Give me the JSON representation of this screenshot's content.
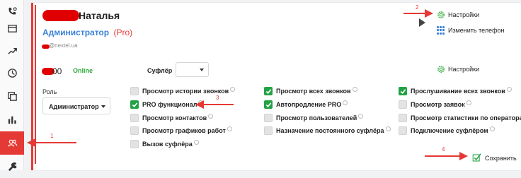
{
  "sidebar": {
    "items": [
      {
        "icon": "phone-gear-icon"
      },
      {
        "icon": "window-icon"
      },
      {
        "icon": "trend-icon"
      },
      {
        "icon": "clock-icon"
      },
      {
        "icon": "copy-icon"
      },
      {
        "icon": "bar-chart-icon"
      },
      {
        "icon": "users-icon"
      },
      {
        "icon": "wrench-icon"
      }
    ],
    "active_index": 6
  },
  "profile": {
    "name": "Наталья",
    "role": "Администратор",
    "role_tag": "(Pro)",
    "email": "@nextel.ua",
    "extension": "00",
    "status": "Online"
  },
  "top_links": {
    "settings": "Настройки",
    "change_phone": "Изменить телефон"
  },
  "sufler": {
    "label": "Суфлёр",
    "value": ""
  },
  "row_settings": "Настройки",
  "role_select": {
    "label": "Роль",
    "value": "Администратор"
  },
  "permissions": {
    "col1": [
      {
        "label": "Просмотр истории звонков",
        "checked": false
      },
      {
        "label": "PRO функционал",
        "checked": true
      },
      {
        "label": "Просмотр контактов",
        "checked": false
      },
      {
        "label": "Просмотр графиков работ",
        "checked": false
      },
      {
        "label": "Вызов суфлёра",
        "checked": false
      }
    ],
    "col2": [
      {
        "label": "Просмотр всех звонков",
        "checked": true
      },
      {
        "label": "Автопродление PRO",
        "checked": true
      },
      {
        "label": "Просмотр пользователей",
        "checked": false
      },
      {
        "label": "Назначение постоянного суфлёра",
        "checked": false
      }
    ],
    "col3": [
      {
        "label": "Прослушивание всех звонков",
        "checked": true
      },
      {
        "label": "Просмотр заявок",
        "checked": false
      },
      {
        "label": "Просмотр статистики по операторам",
        "checked": false
      },
      {
        "label": "Подключение суфлёром",
        "checked": false
      }
    ]
  },
  "save_label": "Сохранить",
  "annotations": [
    "1",
    "2",
    "3",
    "4"
  ],
  "colors": {
    "accent_red": "#e53935",
    "check_green": "#22a244",
    "link_blue": "#3b82d6",
    "online_green": "#2eaa3a"
  }
}
